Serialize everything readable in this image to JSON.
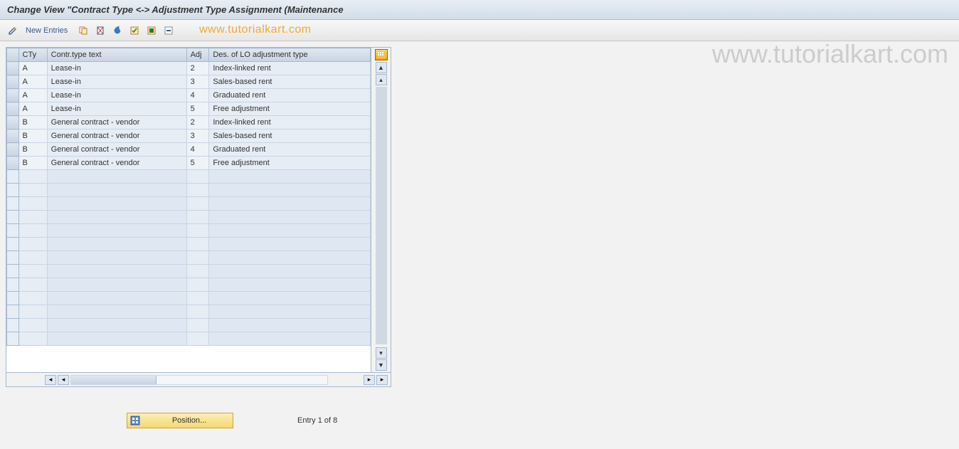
{
  "title": "Change View \"Contract Type <-> Adjustment Type Assignment (Maintenance",
  "toolbar": {
    "new_entries": "New Entries"
  },
  "watermark": "www.tutorialkart.com",
  "table": {
    "headers": {
      "cty": "CTy",
      "desc": "Contr.type text",
      "adj": "Adj",
      "adjdesc": "Des. of LO adjustment type"
    },
    "rows": [
      {
        "cty": "A",
        "desc": "Lease-in",
        "adj": "2",
        "adjdesc": "Index-linked rent"
      },
      {
        "cty": "A",
        "desc": "Lease-in",
        "adj": "3",
        "adjdesc": "Sales-based rent"
      },
      {
        "cty": "A",
        "desc": "Lease-in",
        "adj": "4",
        "adjdesc": "Graduated rent"
      },
      {
        "cty": "A",
        "desc": "Lease-in",
        "adj": "5",
        "adjdesc": "Free adjustment"
      },
      {
        "cty": "B",
        "desc": "General contract - vendor",
        "adj": "2",
        "adjdesc": "Index-linked rent"
      },
      {
        "cty": "B",
        "desc": "General contract - vendor",
        "adj": "3",
        "adjdesc": "Sales-based rent"
      },
      {
        "cty": "B",
        "desc": "General contract - vendor",
        "adj": "4",
        "adjdesc": "Graduated rent"
      },
      {
        "cty": "B",
        "desc": "General contract - vendor",
        "adj": "5",
        "adjdesc": "Free adjustment"
      }
    ],
    "empty_rows": 13
  },
  "footer": {
    "position_label": "Position...",
    "entry_text": "Entry 1 of 8"
  }
}
